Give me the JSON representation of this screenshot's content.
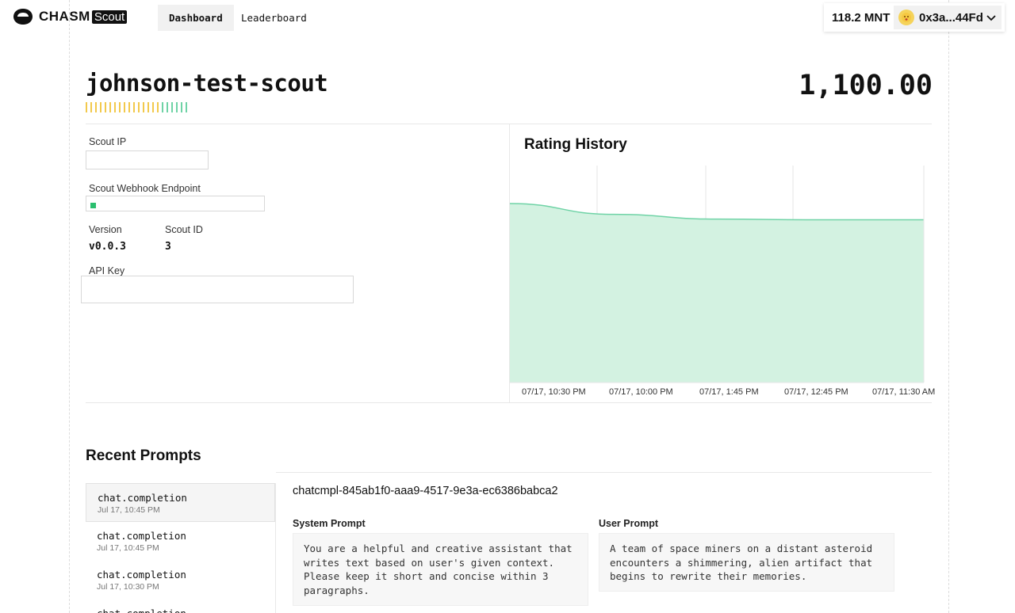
{
  "app": {
    "brand": "CHASM",
    "brand_badge": "Scout"
  },
  "nav": {
    "tabs": [
      {
        "label": "Dashboard",
        "active": true
      },
      {
        "label": "Leaderboard",
        "active": false
      }
    ]
  },
  "wallet": {
    "balance": "118.2 MNT",
    "address": "0x3a...44Fd",
    "avatar_icon": "emoji-face-icon"
  },
  "scout": {
    "name": "johnson-test-scout",
    "rating": "1,100.00",
    "activity_bar_colors": [
      "#f2c94c",
      "#f2c94c",
      "#f2c94c",
      "#f2c94c",
      "#f2c94c",
      "#f2c94c",
      "#f2c94c",
      "#f2c94c",
      "#f2c94c",
      "#f2c94c",
      "#f2c94c",
      "#f2c94c",
      "#f2c94c",
      "#f2c94c",
      "#f2c94c",
      "#f2c94c",
      "#6fd3a6",
      "#6fd3a6",
      "#6fd3a6",
      "#6fd3a6",
      "#6fd3a6",
      "#6fd3a6"
    ],
    "fields": {
      "ip_label": "Scout IP",
      "ip_value": "",
      "webhook_label": "Scout Webhook Endpoint",
      "webhook_value": "",
      "webhook_status_color": "#2bbf6f",
      "version_label": "Version",
      "version_value": "v0.0.3",
      "id_label": "Scout ID",
      "id_value": "3",
      "api_key_label": "API Key",
      "api_key_value": ""
    }
  },
  "rating_history": {
    "title": "Rating History",
    "fill_color": "#d3f2e1",
    "line_color": "#6fd3a6"
  },
  "chart_data": {
    "type": "area",
    "title": "Rating History",
    "x": [
      "07/17, 10:30 PM",
      "07/17, 10:00 PM",
      "07/17, 1:45 PM",
      "07/17, 12:45 PM",
      "07/17, 11:30 AM"
    ],
    "series": [
      {
        "values": [
          1101.2,
          1100.4,
          1100.05,
          1100.0,
          1100.0
        ]
      }
    ],
    "xlabel": "",
    "ylabel": "",
    "grid": true
  },
  "recent_prompts": {
    "title": "Recent Prompts",
    "items": [
      {
        "type": "chat.completion",
        "time": "Jul 17, 10:45 PM",
        "active": true
      },
      {
        "type": "chat.completion",
        "time": "Jul 17, 10:45 PM",
        "active": false
      },
      {
        "type": "chat.completion",
        "time": "Jul 17, 10:30 PM",
        "active": false
      },
      {
        "type": "chat.completion",
        "time": "",
        "active": false
      }
    ],
    "selected": {
      "id": "chatcmpl-845ab1f0-aaa9-4517-9e3a-ec6386babca2",
      "system_label": "System Prompt",
      "system_prompt": "You are a helpful and creative assistant that\nwrites text based on user's given context.\nPlease keep it short and concise within 3\nparagraphs.",
      "user_label": "User Prompt",
      "user_prompt": "A team of space miners on a distant asteroid\nencounters a shimmering, alien artifact that\nbegins to rewrite their memories."
    }
  }
}
